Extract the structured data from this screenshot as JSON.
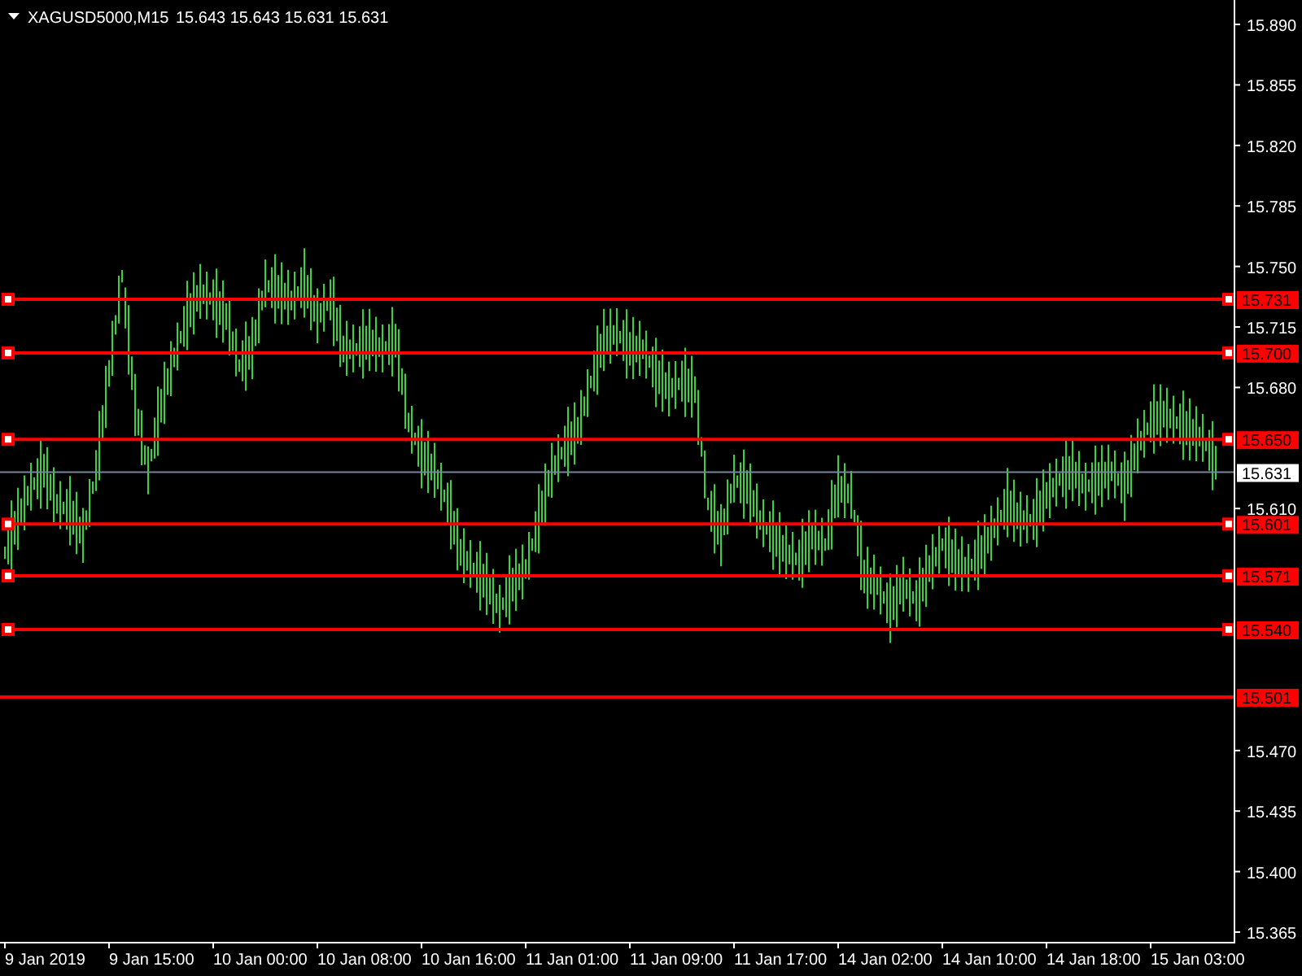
{
  "header": {
    "symbol": "XAGUSD5000,M15",
    "quote": "15.643 15.643 15.631 15.631"
  },
  "price_axis": {
    "labels": [
      "15.890",
      "15.855",
      "15.820",
      "15.785",
      "15.750",
      "15.715",
      "15.680",
      "15.610",
      "15.470",
      "15.435",
      "15.400",
      "15.365"
    ]
  },
  "time_axis": {
    "labels": [
      "9 Jan 2019",
      "9 Jan 15:00",
      "10 Jan 00:00",
      "10 Jan 08:00",
      "10 Jan 16:00",
      "11 Jan 01:00",
      "11 Jan 09:00",
      "11 Jan 17:00",
      "14 Jan 02:00",
      "14 Jan 10:00",
      "14 Jan 18:00",
      "15 Jan 03:00"
    ]
  },
  "lines": [
    {
      "kind": "level",
      "label": "15.731",
      "selected": true
    },
    {
      "kind": "level",
      "label": "15.700",
      "selected": true
    },
    {
      "kind": "level",
      "label": "15.650",
      "selected": true
    },
    {
      "kind": "price",
      "label": "15.631"
    },
    {
      "kind": "level",
      "label": "15.601",
      "selected": true
    },
    {
      "kind": "level",
      "label": "15.571",
      "selected": true
    },
    {
      "kind": "level",
      "label": "15.540",
      "selected": true
    },
    {
      "kind": "level",
      "label": "15.501",
      "selected": false
    }
  ]
}
